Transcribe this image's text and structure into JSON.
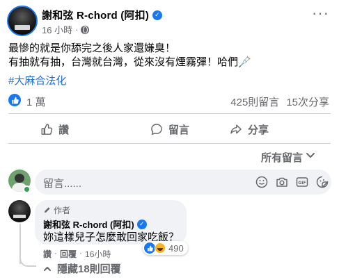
{
  "post": {
    "author": "謝和弦 R-chord (阿扣)",
    "time": "16 小時",
    "more": "···",
    "lines": [
      "最慘的就是你舔完之後人家還嫌臭！",
      "有抽就有抽，台灣就台灣，從來沒有煙霧彈！哈們🩼"
    ],
    "hashtag": "#大麻合法化"
  },
  "reactions": {
    "likes": "1 萬",
    "comments": "425則留言",
    "shares": "15次分享"
  },
  "actions": {
    "like": "讚",
    "comment": "留言",
    "share": "分享"
  },
  "sort": {
    "label": "所有留言"
  },
  "composer": {
    "placeholder": "留言......"
  },
  "comment": {
    "tag": "作者",
    "author": "謝和弦 R-chord (阿扣)",
    "text": "妳這樣兒子怎麼敢回家吃飯？",
    "reaction_count": "490",
    "like": "讚",
    "reply": "回覆",
    "time": "16小時",
    "sep": "·"
  },
  "replies": {
    "hide_label": "隱藏18則回覆"
  },
  "colors": {
    "accent": "#1877f2",
    "muted": "#65676b",
    "bubble": "#f0f2f5"
  }
}
